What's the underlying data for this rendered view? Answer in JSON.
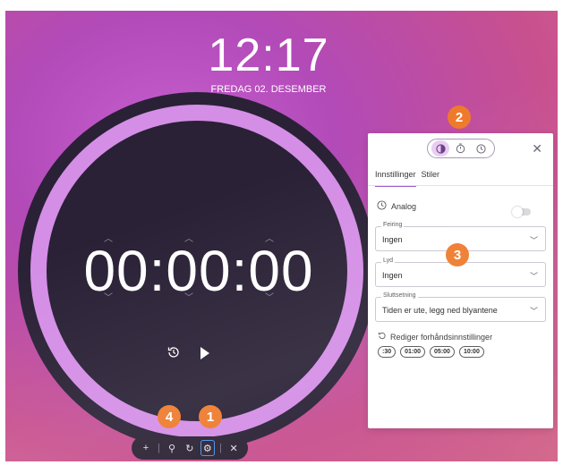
{
  "clock": {
    "time": "12:17",
    "date": "FREDAG 02. DESEMBER"
  },
  "timer": {
    "display": "00:00:00"
  },
  "toolbar": {
    "buttons": [
      {
        "icon": "plus-icon",
        "glyph": "+"
      },
      {
        "icon": "zoom-icon",
        "glyph": "⚲"
      },
      {
        "icon": "refresh-icon",
        "glyph": "↻"
      },
      {
        "icon": "gear-icon",
        "glyph": "⚙"
      },
      {
        "icon": "close-icon",
        "glyph": "✕"
      }
    ]
  },
  "badges": {
    "b1": "1",
    "b2": "2",
    "b3": "3",
    "b4": "4"
  },
  "panel": {
    "tabs": {
      "settings": "Innstillinger",
      "styles": "Stiler"
    },
    "analog_label": "Analog",
    "fields": {
      "celebration": {
        "label": "Feiring",
        "value": "Ingen"
      },
      "sound": {
        "label": "Lyd",
        "value": "Ingen"
      },
      "end_message": {
        "label": "Sluttsetning",
        "value": "Tiden er ute, legg ned blyantene"
      }
    },
    "presets_title": "Rediger forhåndsinnstillinger",
    "presets": [
      ":30",
      "01:00",
      "05:00",
      "10:00"
    ]
  },
  "colors": {
    "accent": "#9c56c8",
    "badge": "#ee7a2c",
    "ring": "#d48ee6",
    "dial": "#2a2136"
  }
}
